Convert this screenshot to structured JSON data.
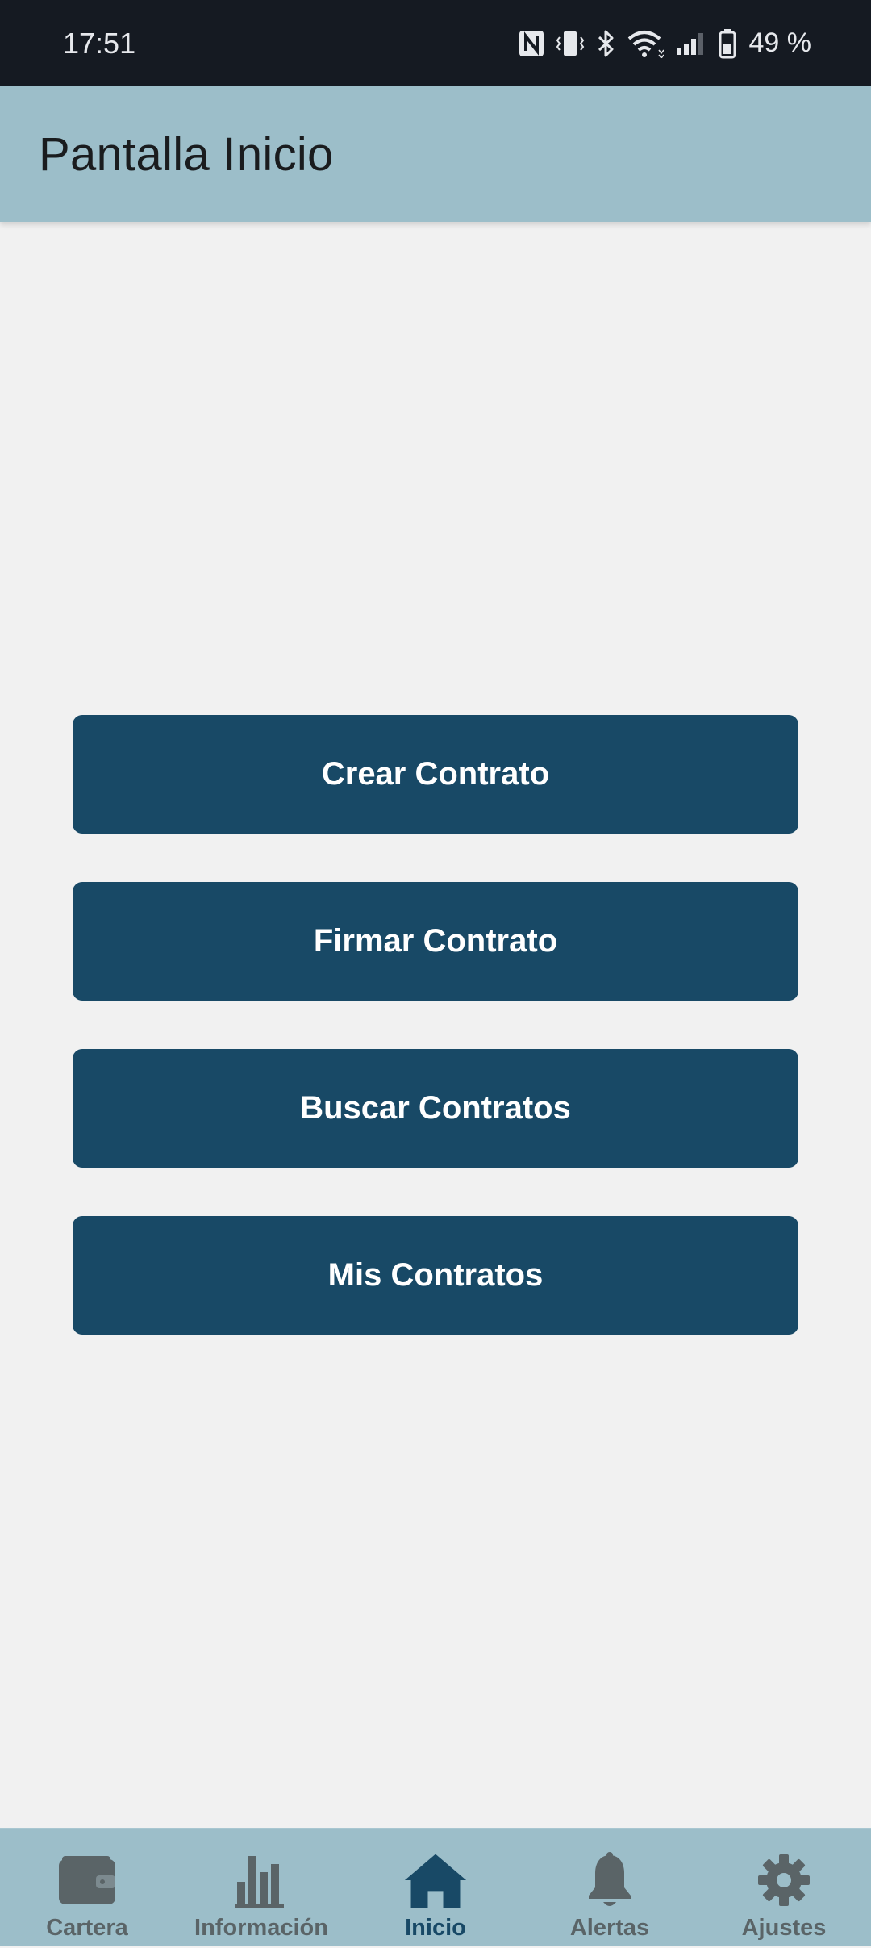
{
  "status_bar": {
    "time": "17:51",
    "battery_percent": "49 %",
    "icons": [
      "nfc-icon",
      "vibrate-icon",
      "bluetooth-icon",
      "wifi-icon",
      "signal-icon",
      "battery-icon"
    ]
  },
  "app_bar": {
    "title": "Pantalla Inicio"
  },
  "actions": {
    "create_label": "Crear Contrato",
    "sign_label": "Firmar Contrato",
    "search_label": "Buscar Contratos",
    "mine_label": "Mis Contratos"
  },
  "bottom_nav": {
    "items": [
      {
        "label": "Cartera",
        "icon": "wallet-icon",
        "active": false
      },
      {
        "label": "Información",
        "icon": "bar-chart-icon",
        "active": false
      },
      {
        "label": "Inicio",
        "icon": "home-icon",
        "active": true
      },
      {
        "label": "Alertas",
        "icon": "bell-icon",
        "active": false
      },
      {
        "label": "Ajustes",
        "icon": "gear-icon",
        "active": false
      }
    ]
  },
  "colors": {
    "primary": "#184966",
    "app_bar": "#9cbec9",
    "background": "#f1f1f1",
    "inactive_nav": "#5a6467",
    "status_bar": "#151a22"
  }
}
